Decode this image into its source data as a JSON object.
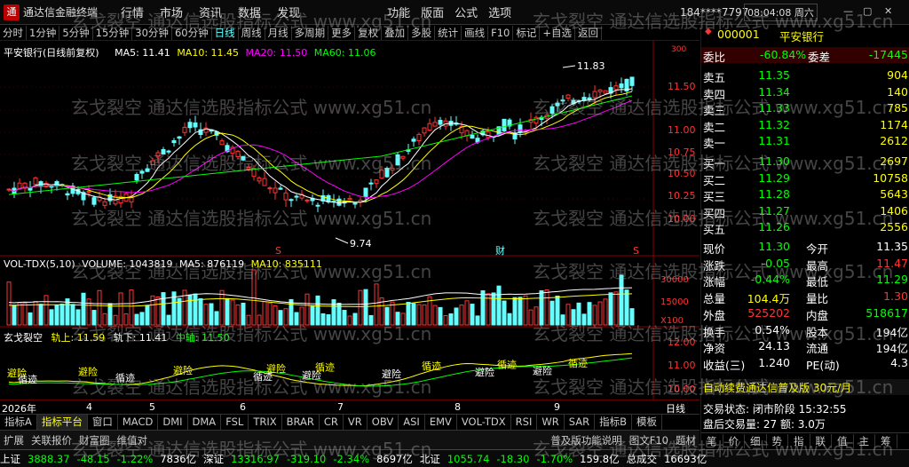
{
  "app": {
    "title": "通达信金融终端",
    "logo_glyph": "通"
  },
  "menu": [
    "行情",
    "市场",
    "资讯",
    "数据",
    "发现"
  ],
  "menu_right": [
    "功能",
    "版面",
    "公式",
    "选项"
  ],
  "user": "184****7797",
  "clock": "08:04:08 周六",
  "toolbar": [
    "分时",
    "1分钟",
    "5分钟",
    "15分钟",
    "30分钟",
    "60分钟",
    "日线",
    "周线",
    "月线",
    "多周期",
    "更多",
    "复权",
    "叠加",
    "多股",
    "统计",
    "画线",
    "F10",
    "标记",
    "+自选",
    "返回"
  ],
  "toolbar_active": "日线",
  "price_header": {
    "name": "平安银行(日线前复权)",
    "ma5": "MA5: 11.41",
    "ma10": "MA10: 11.45",
    "ma20": "MA20: 11.50",
    "ma60": "MA60: 11.06"
  },
  "price_labels": {
    "high": "11.83",
    "low": "9.74",
    "axis": [
      "11.50",
      "11.00",
      "10.75",
      "10.50",
      "10.25",
      "10.00"
    ],
    "top_axis": "300",
    "markers": [
      "S",
      "财",
      "S"
    ]
  },
  "vol_header": {
    "name": "VOL-TDX(5,10)",
    "volume": "VOLUME: 1043819",
    "ma5": "MA5: 876119",
    "ma10": "MA10: 835111"
  },
  "vol_axis": [
    "30000",
    "15000",
    "X100"
  ],
  "ind_header": {
    "name": "玄戈裂空",
    "up": "轨上: 11.59",
    "down": "轨下: 11.41",
    "mid": "中轴: 11.50"
  },
  "ind_axis": [
    "12.00",
    "11.00",
    "10.00"
  ],
  "ind_labels": [
    "避险",
    "循迹",
    "避险",
    "循迹",
    "避险",
    "循迹",
    "避险",
    "避险",
    "循迹",
    "避险",
    "循迹",
    "避险",
    "循迹",
    "避险",
    "循迹"
  ],
  "datebar": {
    "year": "2026年",
    "months": [
      "4",
      "5",
      "6",
      "7",
      "8",
      "9"
    ],
    "period": "日线"
  },
  "tabs": [
    "指标A",
    "指标平台",
    "窗口",
    "MACD",
    "DMI",
    "DMA",
    "FSL",
    "TRIX",
    "BRAR",
    "CR",
    "VR",
    "OBV",
    "ASI",
    "EMV",
    "VOL-TDX",
    "RSI",
    "WR",
    "SAR",
    "指标B",
    "模板"
  ],
  "tabs_active": "指标平台",
  "subtabs": [
    "扩展",
    "关联报价",
    "财富圈",
    "维值对"
  ],
  "subtabs_right": [
    "普及版功能说明",
    "图文F10",
    "题材"
  ],
  "quote": {
    "code": "000001",
    "name": "平安银行",
    "weibi_label": "委比",
    "weibi": "-60.84%",
    "weicha_label": "委差",
    "weicha": "-17445",
    "asks": [
      {
        "label": "卖五",
        "price": "11.35",
        "vol": "904"
      },
      {
        "label": "卖四",
        "price": "11.34",
        "vol": "140"
      },
      {
        "label": "卖三",
        "price": "11.33",
        "vol": "785"
      },
      {
        "label": "卖二",
        "price": "11.32",
        "vol": "1174"
      },
      {
        "label": "卖一",
        "price": "11.31",
        "vol": "2612"
      }
    ],
    "bids": [
      {
        "label": "买一",
        "price": "11.30",
        "vol": "2697"
      },
      {
        "label": "买二",
        "price": "11.29",
        "vol": "10758"
      },
      {
        "label": "买三",
        "price": "11.28",
        "vol": "5643"
      },
      {
        "label": "买四",
        "price": "11.27",
        "vol": "1406"
      },
      {
        "label": "买五",
        "price": "11.26",
        "vol": "2556"
      }
    ],
    "stats": [
      {
        "l1": "现价",
        "v1": "11.30",
        "c1": "green",
        "l2": "今开",
        "v2": "11.35",
        "c2": "white"
      },
      {
        "l1": "涨跌",
        "v1": "-0.05",
        "c1": "green",
        "l2": "最高",
        "v2": "11.47",
        "c2": "red"
      },
      {
        "l1": "涨幅",
        "v1": "-0.44%",
        "c1": "green",
        "l2": "最低",
        "v2": "11.29",
        "c2": "green"
      },
      {
        "l1": "总量",
        "v1": "104.4万",
        "c1": "yellow",
        "l2": "量比",
        "v2": "1.30",
        "c2": "red"
      },
      {
        "l1": "外盘",
        "v1": "525202",
        "c1": "red",
        "l2": "内盘",
        "v2": "518617",
        "c2": "green"
      },
      {
        "l1": "换手",
        "v1": "0.54%",
        "c1": "white",
        "l2": "股本",
        "v2": "194亿",
        "c2": "white"
      },
      {
        "l1": "净资",
        "v1": "24.13",
        "c1": "white",
        "l2": "流通",
        "v2": "194亿",
        "c2": "white"
      },
      {
        "l1": "收益(三)",
        "v1": "1.240",
        "c1": "white",
        "l2": "PE(动)",
        "v2": "4.3",
        "c2": "white"
      }
    ],
    "promo": "自动续费通达信普及版 30元/月",
    "trade_state": "交易状态: 闭市阶段 15:32:55",
    "post_volume": "盘后交易量: 27  额: 3.0万",
    "bottom_tabs": [
      "笔",
      "价",
      "细",
      "势",
      "指",
      "联",
      "值",
      "主",
      "筹"
    ]
  },
  "status": [
    {
      "t": "上证",
      "c": "white"
    },
    {
      "t": "3888.37",
      "c": "green"
    },
    {
      "t": "-48.15",
      "c": "green"
    },
    {
      "t": "-1.22%",
      "c": "green"
    },
    {
      "t": "7836亿",
      "c": "white"
    },
    {
      "t": "深证",
      "c": "white"
    },
    {
      "t": "13316.97",
      "c": "green"
    },
    {
      "t": "-319.10",
      "c": "green"
    },
    {
      "t": "-2.34%",
      "c": "green"
    },
    {
      "t": "8697亿",
      "c": "white"
    },
    {
      "t": "北证",
      "c": "white"
    },
    {
      "t": "1055.74",
      "c": "green"
    },
    {
      "t": "-18.30",
      "c": "green"
    },
    {
      "t": "-1.70%",
      "c": "green"
    },
    {
      "t": "159.8亿",
      "c": "white"
    },
    {
      "t": "总成交",
      "c": "white"
    },
    {
      "t": "16693亿",
      "c": "white"
    }
  ],
  "watermark": "玄戈裂空 通达信选股指标公式 www.xg51.cn"
}
